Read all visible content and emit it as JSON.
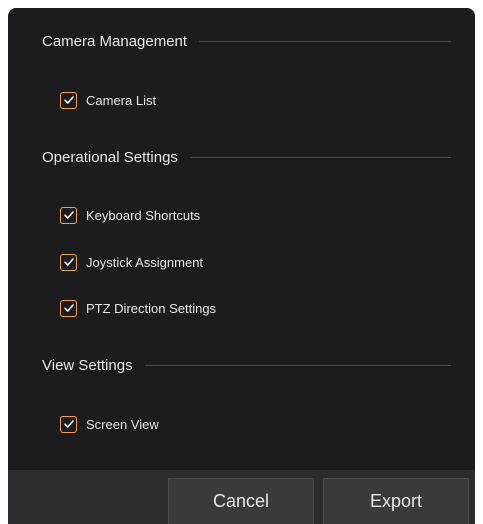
{
  "sections": [
    {
      "title": "Camera Management",
      "items": [
        {
          "label": "Camera List",
          "checked": true
        }
      ]
    },
    {
      "title": "Operational Settings",
      "items": [
        {
          "label": "Keyboard Shortcuts",
          "checked": true
        },
        {
          "label": "Joystick Assignment",
          "checked": true
        },
        {
          "label": "PTZ Direction Settings",
          "checked": true
        }
      ]
    },
    {
      "title": "View Settings",
      "items": [
        {
          "label": "Screen View",
          "checked": true
        }
      ]
    }
  ],
  "footer": {
    "cancel_label": "Cancel",
    "export_label": "Export"
  },
  "colors": {
    "background": "#1c1c1e",
    "footer": "#2c2c2e",
    "checkbox_accent": "#f0a24a",
    "button": "#3a3a3c"
  }
}
